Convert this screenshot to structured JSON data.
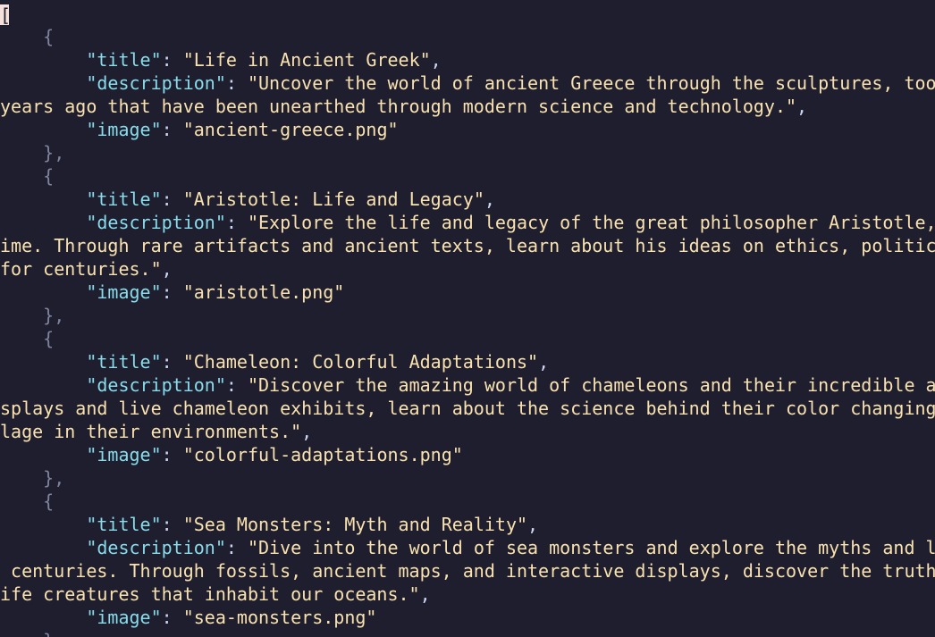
{
  "editor": {
    "cursor_char": "[",
    "lines": [
      {
        "type": "cursor",
        "text": "["
      },
      {
        "type": "brace",
        "indent": 4,
        "text": "{"
      },
      {
        "type": "kv",
        "indent": 8,
        "key": "\"title\"",
        "sep": ": ",
        "value": "\"Life in Ancient Greek\"",
        "tail": ","
      },
      {
        "type": "kv",
        "indent": 8,
        "key": "\"description\"",
        "sep": ": ",
        "value": "\"Uncover the world of ancient Greece through the sculptures, tool",
        "tail": ""
      },
      {
        "type": "str",
        "indent": 0,
        "value": "years ago that have been unearthed through modern science and technology.\"",
        "tail": ","
      },
      {
        "type": "kv",
        "indent": 8,
        "key": "\"image\"",
        "sep": ": ",
        "value": "\"ancient-greece.png\"",
        "tail": ""
      },
      {
        "type": "brace",
        "indent": 4,
        "text": "},"
      },
      {
        "type": "brace",
        "indent": 4,
        "text": "{"
      },
      {
        "type": "kv",
        "indent": 8,
        "key": "\"title\"",
        "sep": ": ",
        "value": "\"Aristotle: Life and Legacy\"",
        "tail": ","
      },
      {
        "type": "kv",
        "indent": 8,
        "key": "\"description\"",
        "sep": ": ",
        "value": "\"Explore the life and legacy of the great philosopher Aristotle,",
        "tail": ""
      },
      {
        "type": "str",
        "indent": 0,
        "value": "ime. Through rare artifacts and ancient texts, learn about his ideas on ethics, politics",
        "tail": ""
      },
      {
        "type": "str",
        "indent": 0,
        "value": "for centuries.\"",
        "tail": ","
      },
      {
        "type": "kv",
        "indent": 8,
        "key": "\"image\"",
        "sep": ": ",
        "value": "\"aristotle.png\"",
        "tail": ""
      },
      {
        "type": "brace",
        "indent": 4,
        "text": "},"
      },
      {
        "type": "brace",
        "indent": 4,
        "text": "{"
      },
      {
        "type": "kv",
        "indent": 8,
        "key": "\"title\"",
        "sep": ": ",
        "value": "\"Chameleon: Colorful Adaptations\"",
        "tail": ","
      },
      {
        "type": "kv",
        "indent": 8,
        "key": "\"description\"",
        "sep": ": ",
        "value": "\"Discover the amazing world of chameleons and their incredible ab",
        "tail": ""
      },
      {
        "type": "str",
        "indent": 0,
        "value": "splays and live chameleon exhibits, learn about the science behind their color changing",
        "tail": ""
      },
      {
        "type": "str",
        "indent": 0,
        "value": "lage in their environments.\"",
        "tail": ","
      },
      {
        "type": "kv",
        "indent": 8,
        "key": "\"image\"",
        "sep": ": ",
        "value": "\"colorful-adaptations.png\"",
        "tail": ""
      },
      {
        "type": "brace",
        "indent": 4,
        "text": "},"
      },
      {
        "type": "brace",
        "indent": 4,
        "text": "{"
      },
      {
        "type": "kv",
        "indent": 8,
        "key": "\"title\"",
        "sep": ": ",
        "value": "\"Sea Monsters: Myth and Reality\"",
        "tail": ","
      },
      {
        "type": "kv",
        "indent": 8,
        "key": "\"description\"",
        "sep": ": ",
        "value": "\"Dive into the world of sea monsters and explore the myths and le",
        "tail": ""
      },
      {
        "type": "str",
        "indent": 0,
        "value": " centuries. Through fossils, ancient maps, and interactive displays, discover the truth",
        "tail": ""
      },
      {
        "type": "str",
        "indent": 0,
        "value": "ife creatures that inhabit our oceans.\"",
        "tail": ","
      },
      {
        "type": "kv",
        "indent": 8,
        "key": "\"image\"",
        "sep": ": ",
        "value": "\"sea-monsters.png\"",
        "tail": ""
      },
      {
        "type": "brace",
        "indent": 4,
        "text": "}"
      }
    ]
  },
  "colors": {
    "background": "#1e1e2e",
    "key": "#89dceb",
    "string": "#f9e2af",
    "punctuation": "#cdd6f4",
    "brace": "#7f849c",
    "cursor": "#f5e0dc"
  }
}
